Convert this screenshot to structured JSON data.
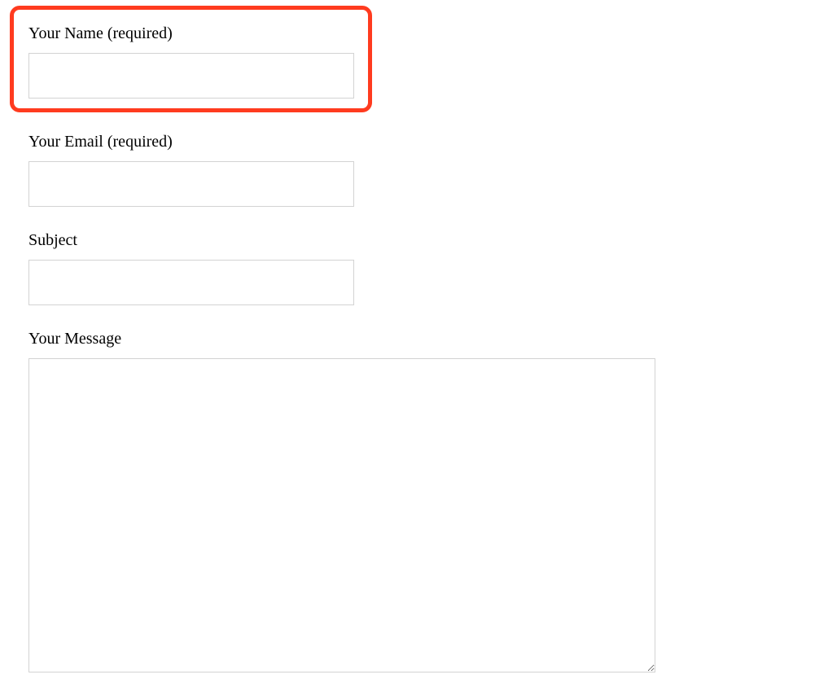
{
  "form": {
    "name": {
      "label": "Your Name (required)",
      "value": ""
    },
    "email": {
      "label": "Your Email (required)",
      "value": ""
    },
    "subject": {
      "label": "Subject",
      "value": ""
    },
    "message": {
      "label": "Your Message",
      "value": ""
    }
  }
}
